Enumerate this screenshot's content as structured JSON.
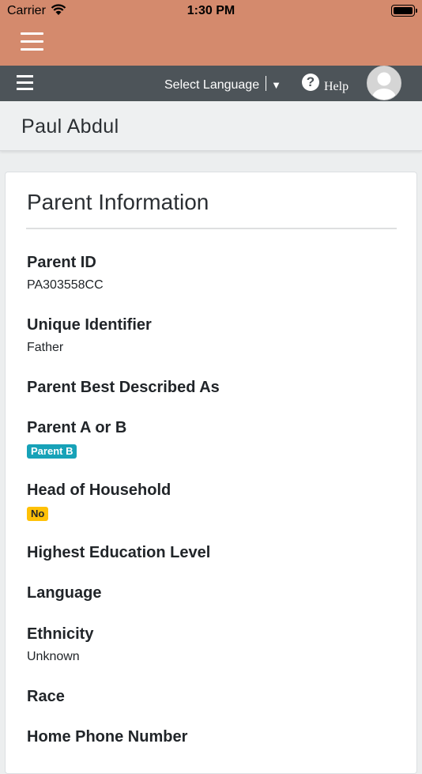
{
  "status_bar": {
    "carrier": "Carrier",
    "time": "1:30 PM"
  },
  "navbar": {
    "language_label": "Select Language",
    "language_caret": "▼",
    "help_label": "Help"
  },
  "header": {
    "person_name": "Paul Abdul"
  },
  "card": {
    "title": "Parent Information",
    "fields": {
      "parent_id": {
        "label": "Parent ID",
        "value": "PA303558CC"
      },
      "unique_identifier": {
        "label": "Unique Identifier",
        "value": "Father"
      },
      "best_described": {
        "label": "Parent Best Described As"
      },
      "parent_a_or_b": {
        "label": "Parent A or B",
        "badge": "Parent B"
      },
      "head_of_household": {
        "label": "Head of Household",
        "badge": "No"
      },
      "education": {
        "label": "Highest Education Level"
      },
      "language": {
        "label": "Language"
      },
      "ethnicity": {
        "label": "Ethnicity",
        "value": "Unknown"
      },
      "race": {
        "label": "Race"
      },
      "home_phone": {
        "label": "Home Phone Number"
      }
    }
  },
  "colors": {
    "app_bar": "#d48a6d",
    "nav_bar": "#4d5459",
    "badge_info": "#17a2b8",
    "badge_warning": "#ffc107"
  },
  "icons": [
    "hamburger-icon",
    "wifi-icon",
    "battery-icon",
    "help-icon",
    "avatar-icon"
  ]
}
